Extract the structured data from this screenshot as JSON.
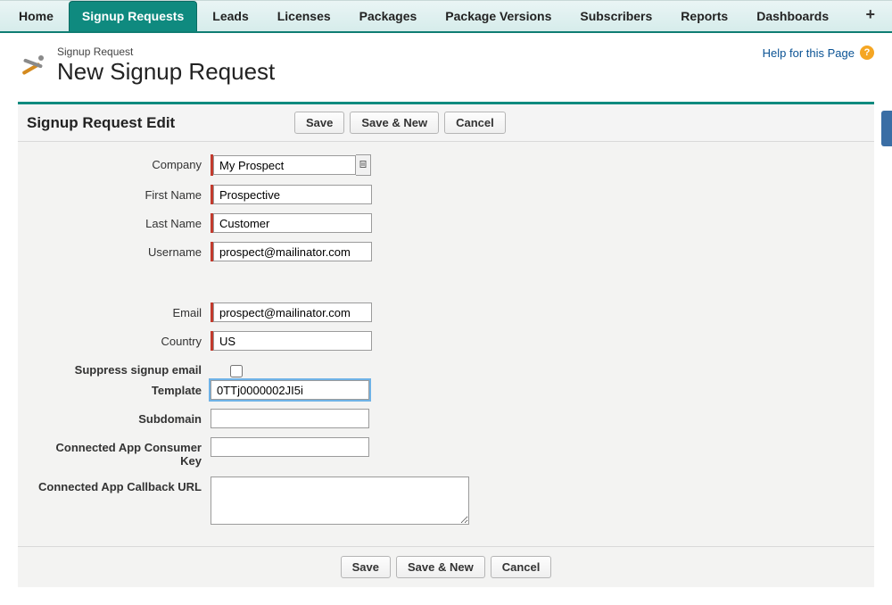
{
  "nav": {
    "tabs": [
      {
        "label": "Home"
      },
      {
        "label": "Signup Requests",
        "active": true
      },
      {
        "label": "Leads"
      },
      {
        "label": "Licenses"
      },
      {
        "label": "Packages"
      },
      {
        "label": "Package Versions"
      },
      {
        "label": "Subscribers"
      },
      {
        "label": "Reports"
      },
      {
        "label": "Dashboards"
      }
    ],
    "plus": "+"
  },
  "header": {
    "object_label": "Signup Request",
    "page_title": "New Signup Request",
    "help_link": "Help for this Page"
  },
  "section_title": "Signup Request Edit",
  "buttons": {
    "save": "Save",
    "save_new": "Save & New",
    "cancel": "Cancel"
  },
  "fields": {
    "left": {
      "company": {
        "label": "Company",
        "value": "My Prospect",
        "required": true,
        "lookup": true
      },
      "first_name": {
        "label": "First Name",
        "value": "Prospective",
        "required": true
      },
      "last_name": {
        "label": "Last Name",
        "value": "Customer",
        "required": true
      },
      "username": {
        "label": "Username",
        "value": "prospect@mailinator.com",
        "required": true
      },
      "email": {
        "label": "Email",
        "value": "prospect@mailinator.com",
        "required": true
      },
      "country": {
        "label": "Country",
        "value": "US",
        "required": true
      },
      "suppress": {
        "label": "Suppress signup email",
        "checked": false
      }
    },
    "right": {
      "template": {
        "label": "Template",
        "value": "0TTj0000002JI5i",
        "focused": true
      },
      "subdomain": {
        "label": "Subdomain",
        "value": ""
      },
      "consumer_key": {
        "label": "Connected App Consumer Key",
        "value": ""
      },
      "callback_url": {
        "label": "Connected App Callback URL",
        "value": ""
      }
    }
  }
}
